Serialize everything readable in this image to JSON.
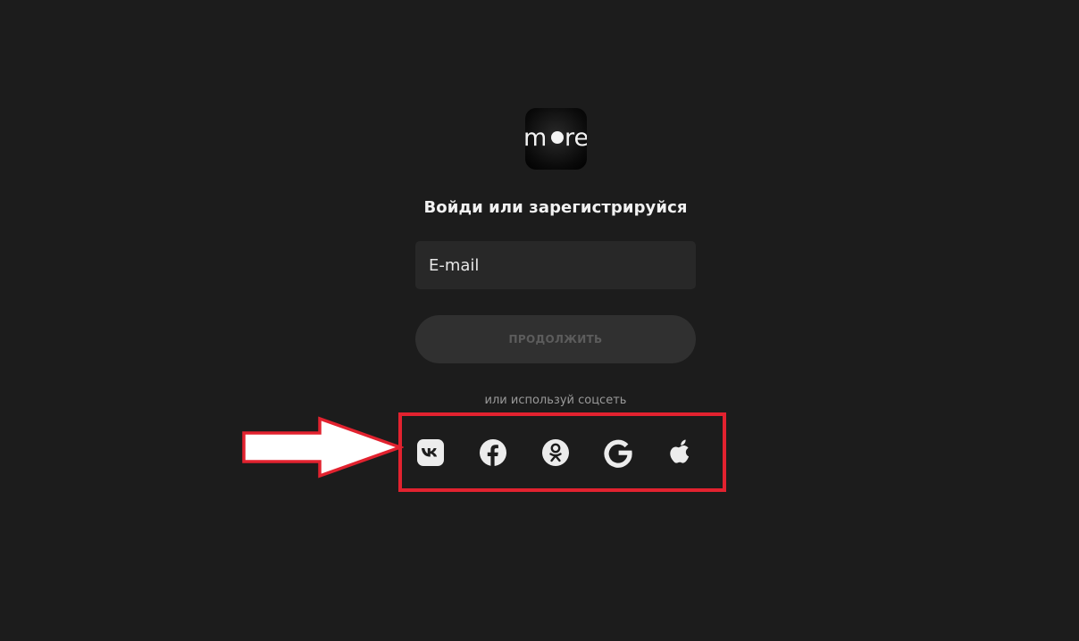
{
  "brand": {
    "logo_text": "more"
  },
  "auth": {
    "heading": "Войди или зарегистрируйся",
    "email_placeholder": "E-mail",
    "continue_label": "ПРОДОЛЖИТЬ",
    "social_prompt": "или используй соцсеть"
  },
  "social": [
    {
      "icon": "vk-icon"
    },
    {
      "icon": "facebook-icon"
    },
    {
      "icon": "odnoklassniki-icon"
    },
    {
      "icon": "google-icon"
    },
    {
      "icon": "apple-icon"
    }
  ],
  "colors": {
    "background": "#1c1c1c",
    "highlight_frame": "#e2222f",
    "annotation_arrow": "#ffffff"
  }
}
